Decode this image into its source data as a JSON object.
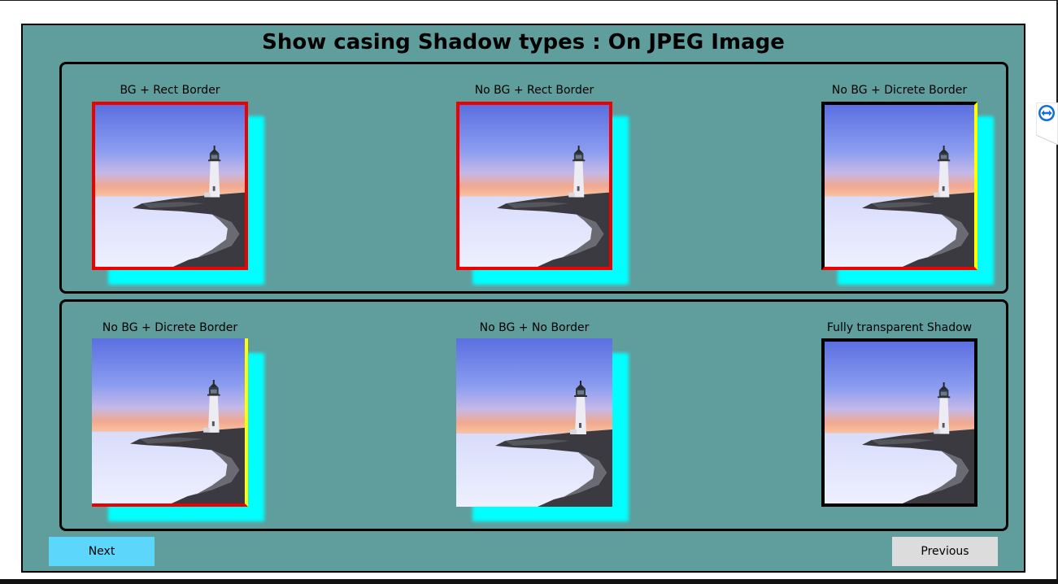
{
  "header": {
    "title": "Show casing Shadow types : On JPEG Image"
  },
  "row1": [
    {
      "label": "BG + Rect Border"
    },
    {
      "label": "No BG + Rect Border"
    },
    {
      "label": "No BG + Dicrete Border"
    }
  ],
  "row2": [
    {
      "label": "No BG + Dicrete Border"
    },
    {
      "label": "No BG + No Border"
    },
    {
      "label": "Fully transparent Shadow"
    }
  ],
  "buttons": {
    "next": "Next",
    "previous": "Previous"
  },
  "colors": {
    "panel_bg": "#5f9e9d",
    "shadow": "#00ffff",
    "border_red": "#ee0000",
    "border_yellow": "#ffff00",
    "next_button": "#5cd6fa",
    "previous_button": "#dcdcdc"
  },
  "icons": {
    "side_tab": "teamviewer-arrows-icon"
  }
}
